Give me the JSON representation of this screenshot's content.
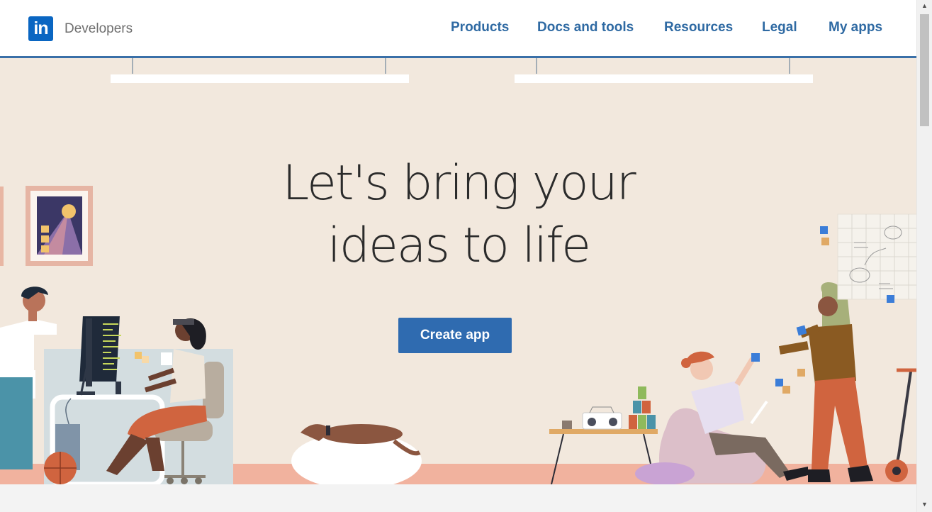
{
  "header": {
    "logo_text": "in",
    "brand": "Developers",
    "nav": [
      "Products",
      "Docs and tools",
      "Resources",
      "Legal",
      "My apps"
    ]
  },
  "hero": {
    "headline_line1": "Let's bring your",
    "headline_line2": "ideas to life",
    "cta_label": "Create app"
  },
  "colors": {
    "accent": "#2f6bb0",
    "hero_background": "#f2e8dd",
    "nav_link": "#2f6aa3"
  }
}
